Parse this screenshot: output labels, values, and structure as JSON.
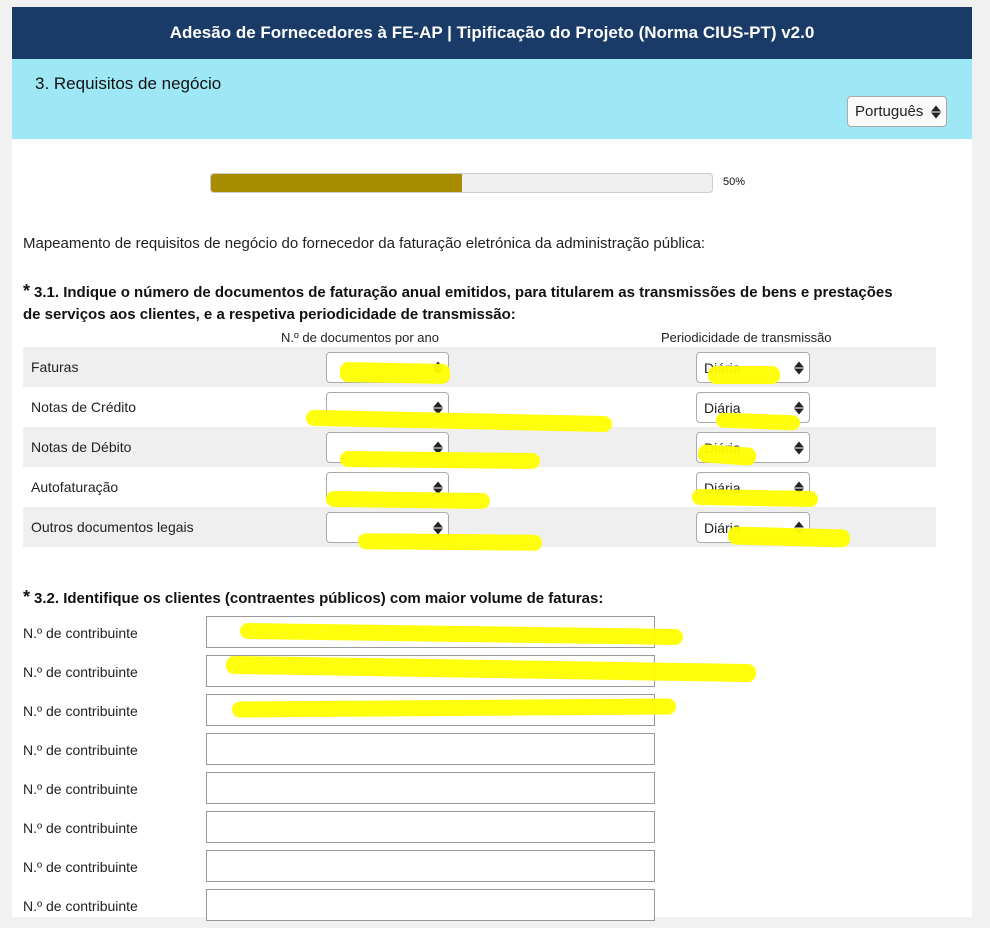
{
  "header": {
    "title": "Adesão de Fornecedores à FE-AP | Tipificação do Projeto (Norma CIUS-PT) v2.0"
  },
  "subheader": {
    "section_title": "3. Requisitos de negócio",
    "language": "Português"
  },
  "progress": {
    "percent": 50,
    "label": "50%"
  },
  "intro": "Mapeamento de requisitos de negócio do fornecedor da faturação eletrónica da administração pública:",
  "q1": {
    "star": "*",
    "title": "3.1. Indique o número de documentos de faturação anual emitidos, para titularem as transmissões de bens e prestações de serviços aos clientes, e a respetiva periodicidade de transmissão:",
    "col_docs": "N.º de documentos por ano",
    "col_freq": "Periodicidade de transmissão",
    "rows": [
      {
        "label": "Faturas",
        "docs": "",
        "freq": "Diária"
      },
      {
        "label": "Notas de Crédito",
        "docs": "",
        "freq": "Diária"
      },
      {
        "label": "Notas de Débito",
        "docs": "",
        "freq": "Diária"
      },
      {
        "label": "Autofaturação",
        "docs": "",
        "freq": "Diária"
      },
      {
        "label": "Outros documentos legais",
        "docs": "",
        "freq": "Diária"
      }
    ]
  },
  "q2": {
    "star": "*",
    "title": "3.2. Identifique os clientes (contraentes públicos) com maior volume de faturas:",
    "rows": [
      {
        "label": "N.º de contribuinte",
        "value": ""
      },
      {
        "label": "N.º de contribuinte",
        "value": ""
      },
      {
        "label": "N.º de contribuinte",
        "value": ""
      },
      {
        "label": "N.º de contribuinte",
        "value": ""
      },
      {
        "label": "N.º de contribuinte",
        "value": ""
      },
      {
        "label": "N.º de contribuinte",
        "value": ""
      },
      {
        "label": "N.º de contribuinte",
        "value": ""
      },
      {
        "label": "N.º de contribuinte",
        "value": ""
      }
    ]
  },
  "colors": {
    "header_bg": "#1a3b68",
    "subheader_bg": "#9ee7f5",
    "progress_fill": "#a88c00",
    "highlight": "#ffff00"
  },
  "icons": {
    "select_arrows": "up-down-arrows-icon"
  }
}
